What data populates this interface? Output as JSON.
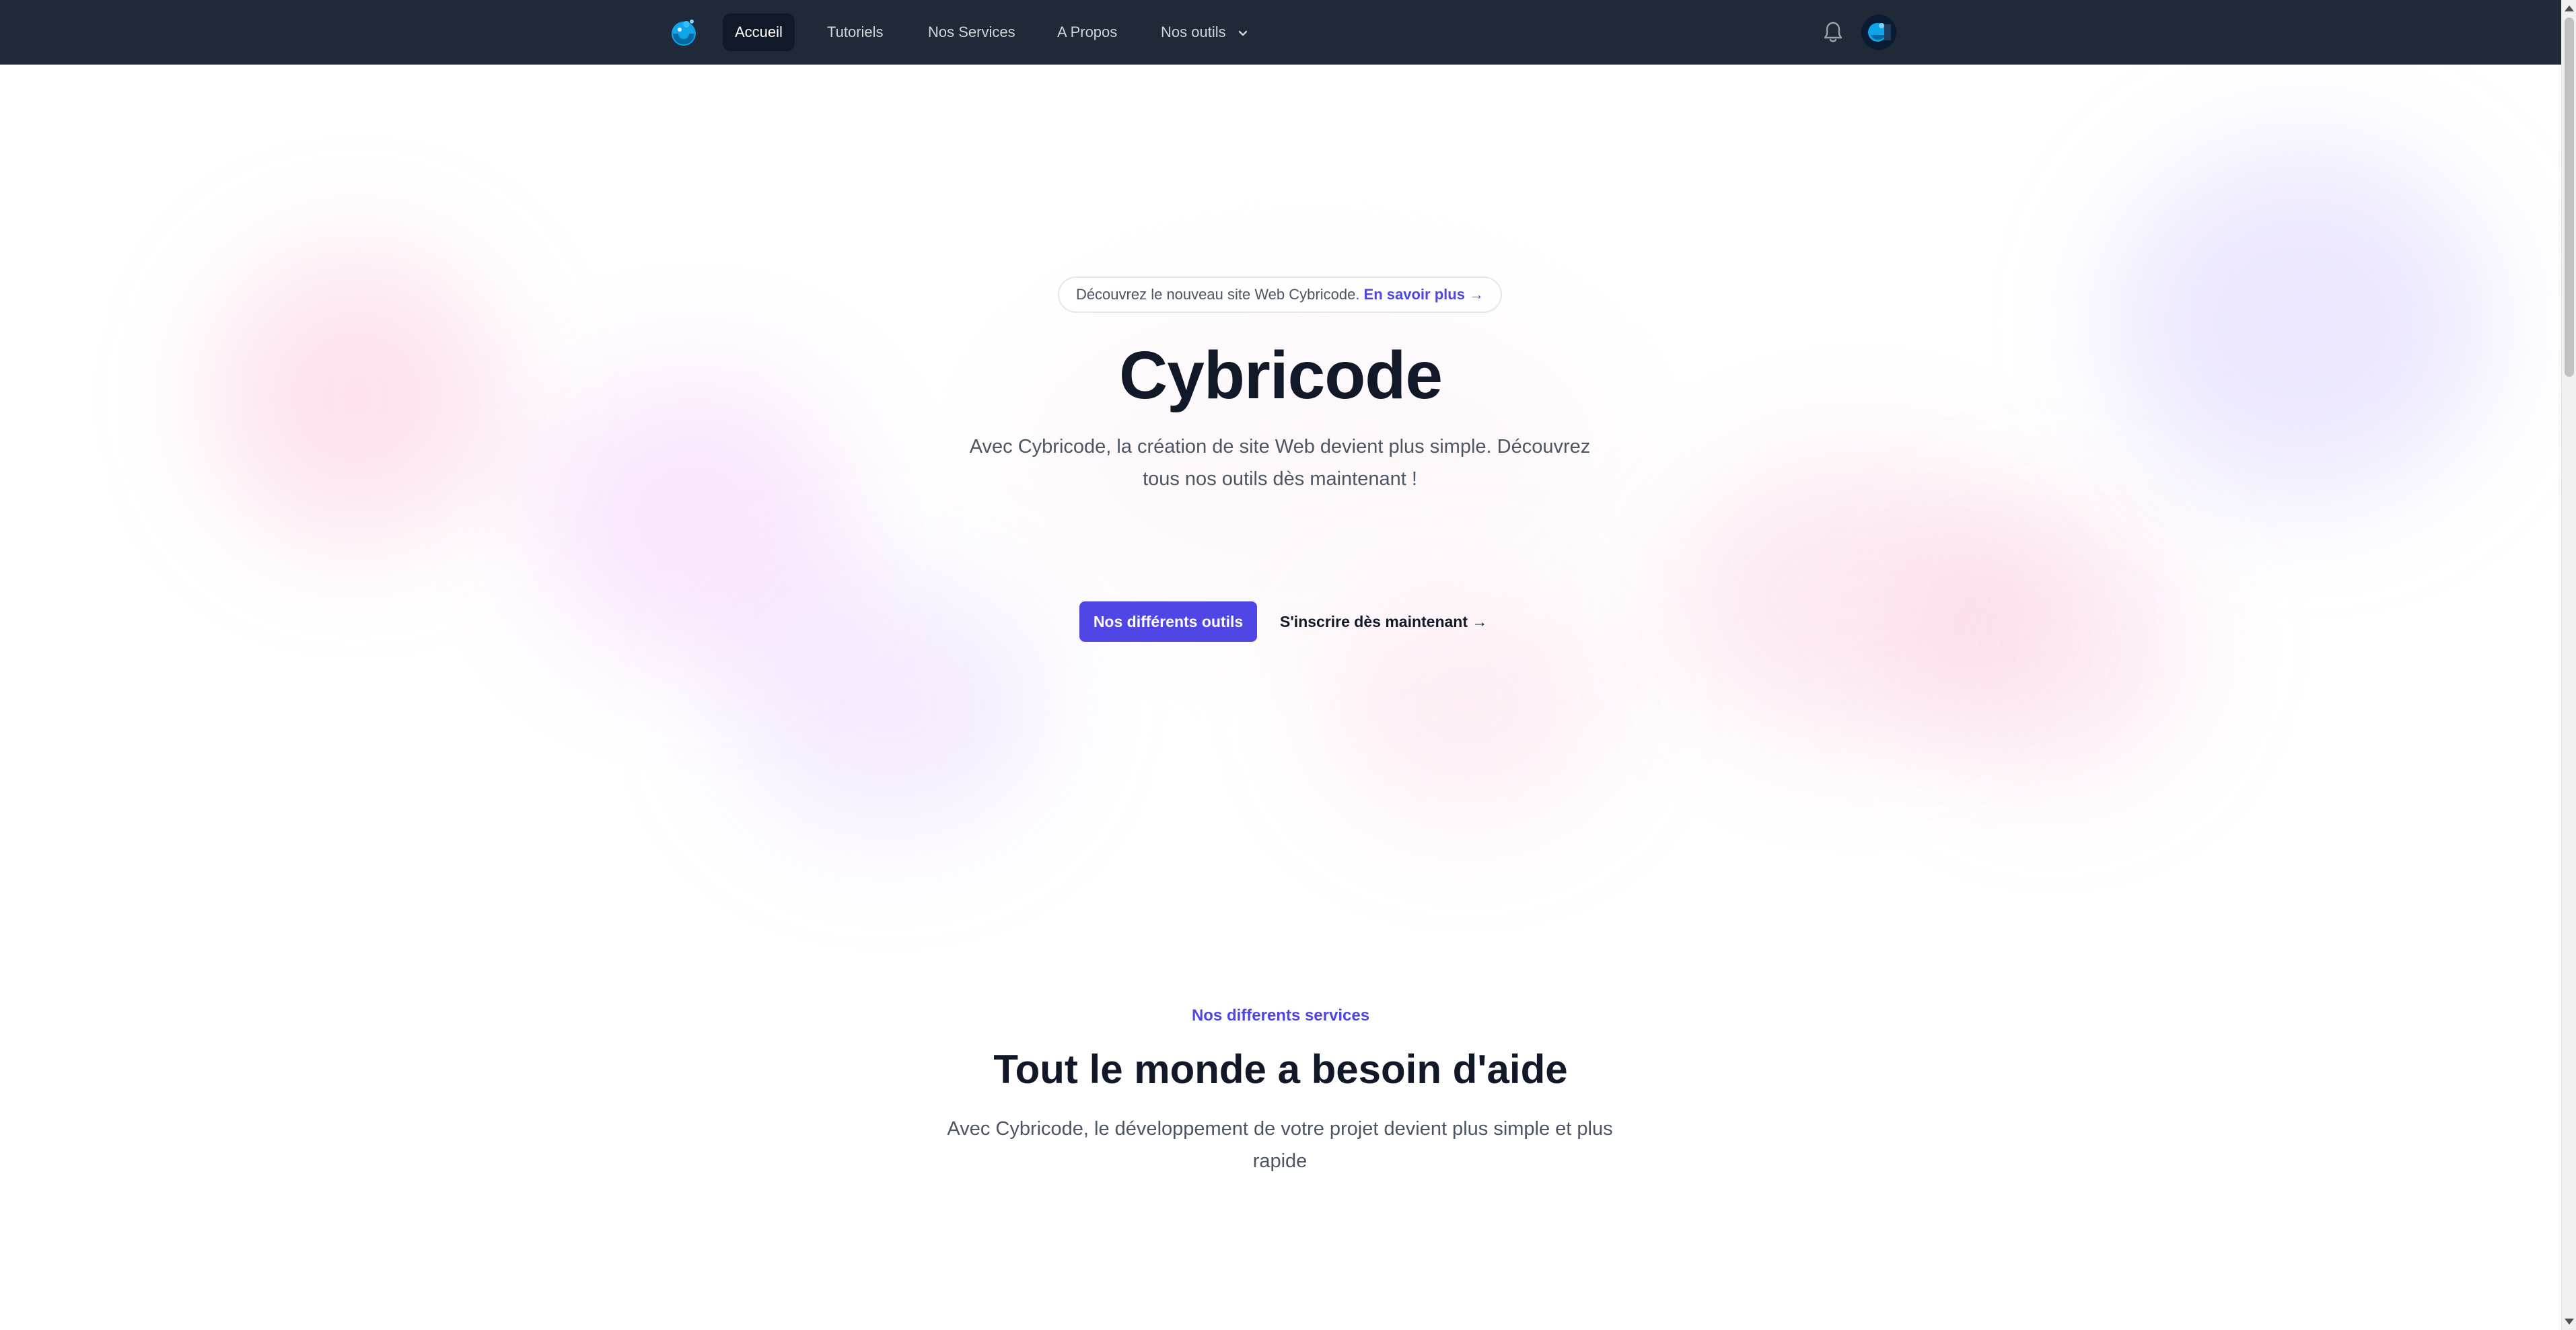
{
  "nav": {
    "logo_icon": "cybricode-logo-icon",
    "items": [
      {
        "label": "Accueil",
        "active": true
      },
      {
        "label": "Tutoriels",
        "active": false
      },
      {
        "label": "Nos Services",
        "active": false
      },
      {
        "label": "A Propos",
        "active": false
      },
      {
        "label": "Nos outils",
        "active": false,
        "has_dropdown": true
      }
    ],
    "notification_icon": "bell-icon",
    "avatar_icon": "user-avatar"
  },
  "hero": {
    "announce_text": "Découvrez le nouveau site Web Cybricode.",
    "announce_link": "En savoir plus →",
    "title": "Cybricode",
    "subtitle": "Avec Cybricode, la création de site Web devient plus simple. Découvrez tous nos outils dès maintenant !",
    "primary_button": "Nos différents outils",
    "secondary_button": "S'inscrire dès maintenant →"
  },
  "services": {
    "kicker": "Nos differents services",
    "title": "Tout le monde a besoin d'aide",
    "subtitle": "Avec Cybricode, le développement de votre projet devient plus simple et plus rapide"
  },
  "colors": {
    "navbar_bg": "#1f2937",
    "accent": "#4f46e5",
    "text_dark": "#111827",
    "text_muted": "#4b5563"
  }
}
